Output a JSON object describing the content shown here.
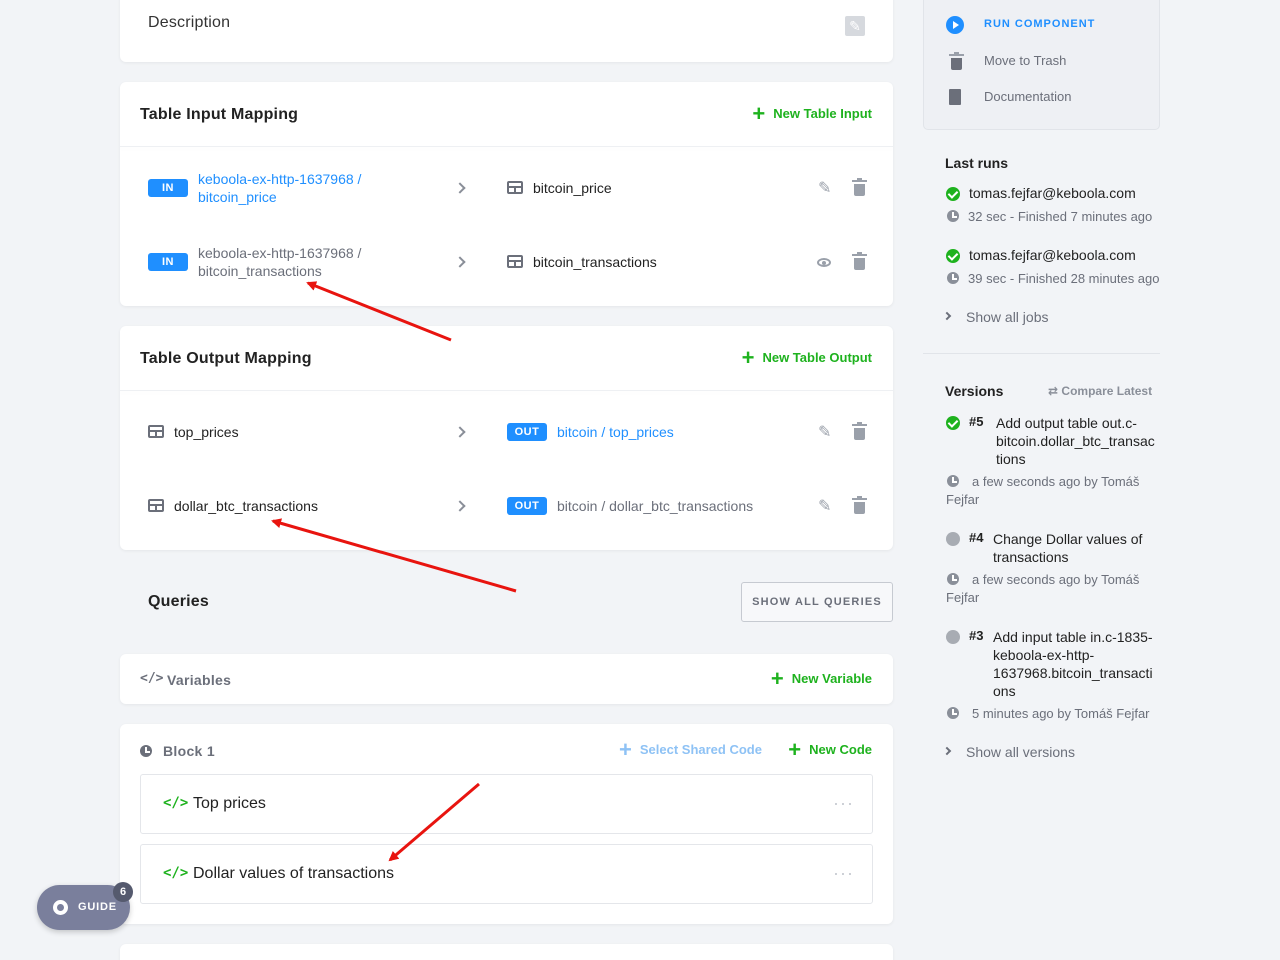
{
  "description": {
    "title": "Description"
  },
  "input_mapping": {
    "title": "Table Input Mapping",
    "new_label": "New Table Input",
    "rows": [
      {
        "badge": "IN",
        "source_line1": "keboola-ex-http-1637968 /",
        "source_line2": "bitcoin_price",
        "dest": "bitcoin_price"
      },
      {
        "badge": "IN",
        "source_line1": "keboola-ex-http-1637968 /",
        "source_line2": "bitcoin_transactions",
        "dest": "bitcoin_transactions"
      }
    ]
  },
  "output_mapping": {
    "title": "Table Output Mapping",
    "new_label": "New Table Output",
    "rows": [
      {
        "source": "top_prices",
        "badge": "OUT",
        "dest": "bitcoin / top_prices"
      },
      {
        "source": "dollar_btc_transactions",
        "badge": "OUT",
        "dest": "bitcoin / dollar_btc_transactions"
      }
    ]
  },
  "queries": {
    "title": "Queries",
    "show_all_label": "SHOW ALL QUERIES"
  },
  "variables": {
    "title": "Variables",
    "new_label": "New Variable"
  },
  "block": {
    "title": "Block 1",
    "select_shared_label": "Select Shared Code",
    "new_code_label": "New Code",
    "codes": [
      {
        "name": "Top prices"
      },
      {
        "name": "Dollar values of transactions"
      }
    ]
  },
  "guide": {
    "label": "GUIDE",
    "count": "6"
  },
  "sidebar": {
    "actions": {
      "run": "RUN COMPONENT",
      "trash": "Move to Trash",
      "docs": "Documentation"
    },
    "last_runs": {
      "title": "Last runs",
      "items": [
        {
          "user": "tomas.fejfar@keboola.com",
          "info": "32 sec - Finished 7 minutes ago"
        },
        {
          "user": "tomas.fejfar@keboola.com",
          "info": "39 sec - Finished 28 minutes ago"
        }
      ],
      "show_all": "Show all jobs"
    },
    "versions": {
      "title": "Versions",
      "compare_label": "Compare Latest",
      "items": [
        {
          "num": "#5",
          "line1": "Add output table out.c-",
          "line2": "bitcoin.dollar_btc_transac",
          "line3": "tions",
          "meta1": "a few seconds ago by Tomáš",
          "meta2": "Fejfar"
        },
        {
          "num": "#4",
          "line1": "Change Dollar values of",
          "line2": "transactions",
          "meta1": "a few seconds ago by Tomáš",
          "meta2": "Fejfar"
        },
        {
          "num": "#3",
          "line1": "Add input table in.c-1835-",
          "line2": "keboola-ex-http-",
          "line3": "1637968.bitcoin_transacti",
          "line4": "ons",
          "meta1": "5 minutes ago by Tomáš Fejfar"
        }
      ],
      "show_all": "Show all versions"
    }
  }
}
